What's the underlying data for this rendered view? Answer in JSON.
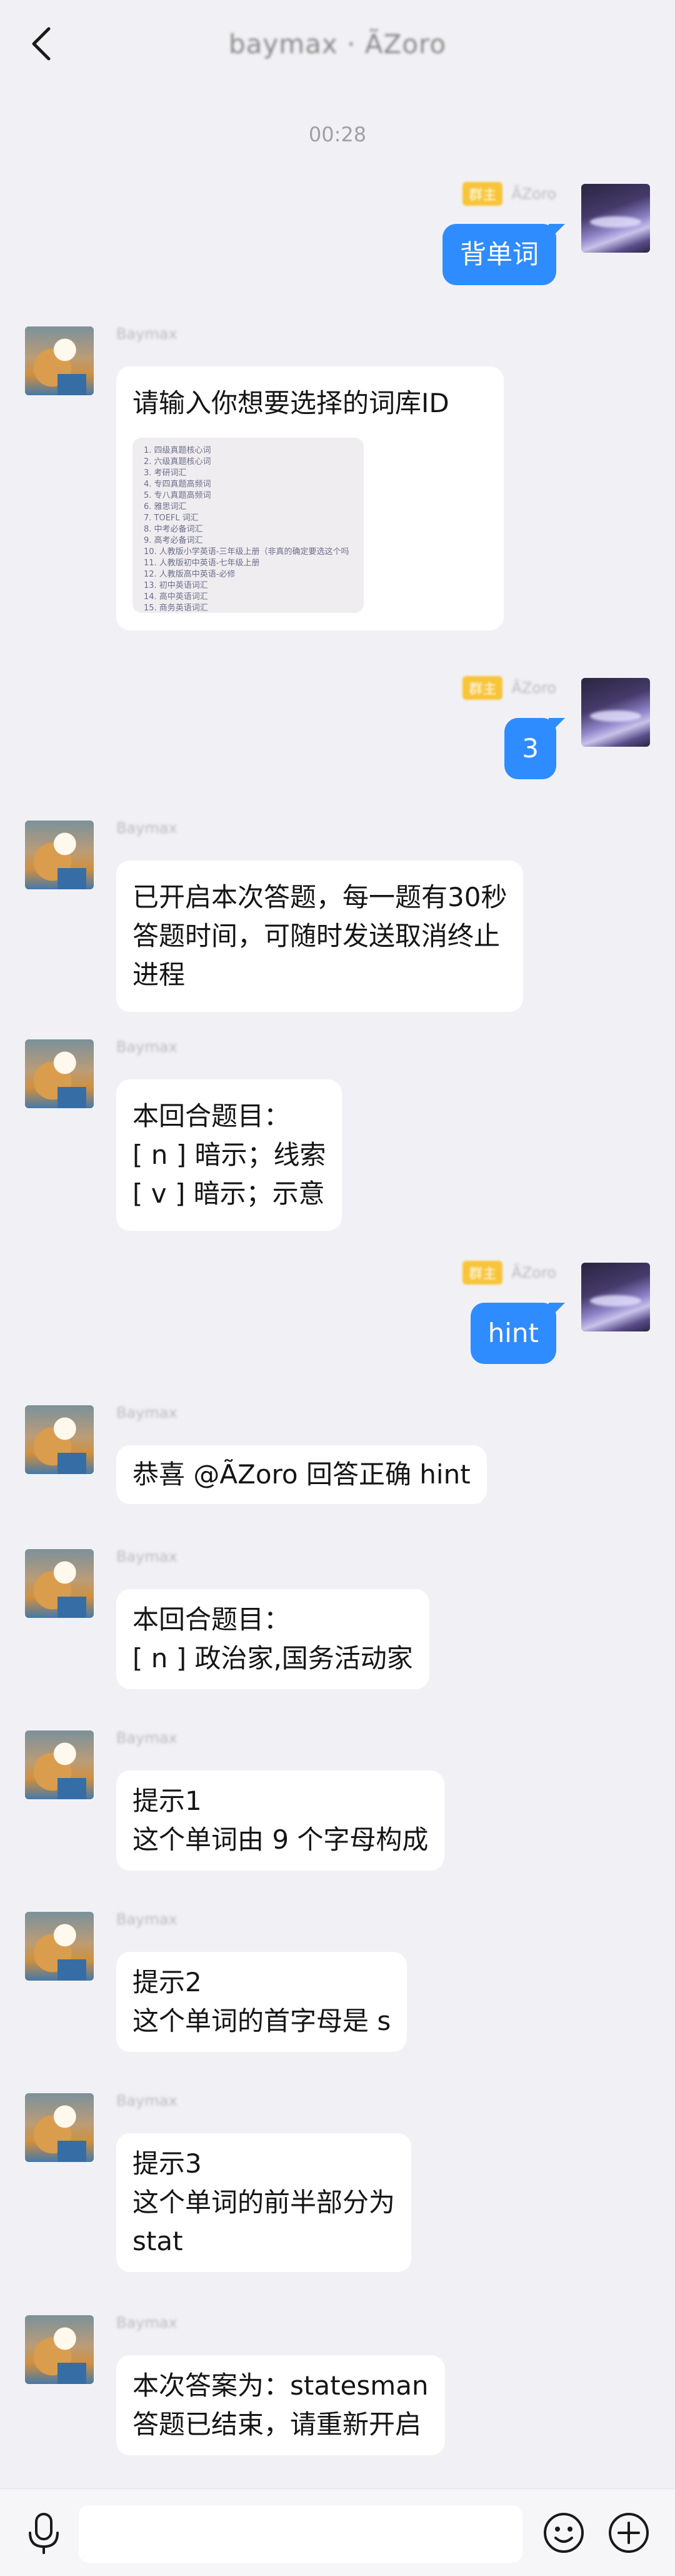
{
  "header": {
    "title": "baymax · ÃZoro"
  },
  "timestamp": "00:28",
  "me": {
    "badge": "群主",
    "name": "ÃZoro"
  },
  "bot": {
    "name": "Baymax"
  },
  "messages": {
    "m1": "背单词",
    "m2_line1": "请输入你想要选择的词库ID",
    "m3": "3",
    "m4_line1": "已开启本次答题，每一题有30秒",
    "m4_line2": "答题时间，可随时发送取消终止",
    "m4_line3": "进程",
    "m5_line1": "本回合题目：",
    "m5_line2": "[ n ] 暗示；线索",
    "m5_line3": "[ v ] 暗示；示意",
    "m6": "hint",
    "m7": "恭喜 @ÃZoro 回答正确 hint",
    "m8_line1": "本回合题目：",
    "m8_line2": "[ n ] 政治家,国务活动家",
    "m9_line1": "提示1",
    "m9_line2": "这个单词由 9 个字母构成",
    "m10_line1": "提示2",
    "m10_line2": "这个单词的首字母是 s",
    "m11_line1": "提示3",
    "m11_line2": "这个单词的前半部分为",
    "m11_line3": "stat",
    "m12_line1": "本次答案为：statesman",
    "m12_line2": "答题已结束，请重新开启"
  },
  "library_list": {
    "items": [
      "1. 四级真题核心词",
      "2. 六级真题核心词",
      "3. 考研词汇",
      "4. 专四真题高频词",
      "5. 专八真题高频词",
      "6. 雅思词汇",
      "7. TOEFL 词汇",
      "8. 中考必备词汇",
      "9. 高考必备词汇",
      "10. 人教版小学英语-三年级上册（非真的确定要选这个吗",
      "11. 人教版初中英语-七年级上册",
      "12. 人教版高中英语-必修",
      "13. 初中英语词汇",
      "14. 高中英语词汇",
      "15. 商务英语词汇"
    ]
  },
  "input": {
    "placeholder": ""
  },
  "colors": {
    "accent": "#2f8cff",
    "background": "#f1f1f5",
    "badge": "#f7c43a"
  }
}
